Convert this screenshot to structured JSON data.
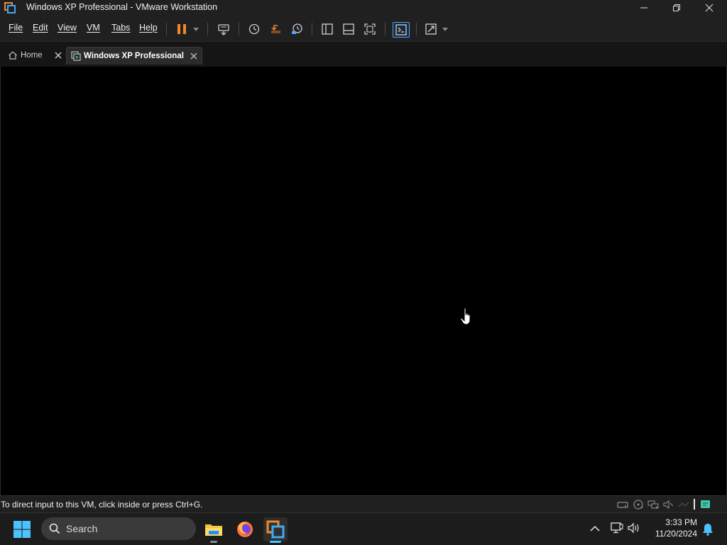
{
  "window": {
    "title": "Windows XP Professional - VMware Workstation",
    "controls": [
      "minimize-icon",
      "restore-icon",
      "close-icon"
    ]
  },
  "menu": {
    "items": [
      "File",
      "Edit",
      "View",
      "VM",
      "Tabs",
      "Help"
    ]
  },
  "toolbar": {
    "buttons": [
      "pause-icon",
      "dropdown-arrow-icon",
      "send-ctrl-alt-del-icon",
      "snapshot-icon",
      "revert-snapshot-icon",
      "snapshot-manager-icon",
      "show-library-icon",
      "thumbnail-bar-icon",
      "full-screen-icon",
      "console-view-icon",
      "stretch-guest-icon",
      "dropdown-arrow-icon"
    ],
    "pause_color": "#f0892d",
    "active_color": "#4da3ff"
  },
  "tabs": [
    {
      "label": "Home",
      "icon": "home-icon",
      "active": false
    },
    {
      "label": "Windows XP Professional",
      "icon": "vm-icon",
      "active": true
    }
  ],
  "statusbar": {
    "message": "To direct input to this VM, click inside or press Ctrl+G.",
    "devices": [
      "hard-disk-icon",
      "cd-dvd-icon",
      "network-adapter-icon",
      "sound-card-icon",
      "usb-icon",
      "message-log-icon"
    ]
  },
  "taskbar": {
    "search_placeholder": "Search",
    "apps": [
      "file-explorer-icon",
      "firefox-icon",
      "vmware-workstation-icon"
    ],
    "tray": [
      "show-hidden-icons-icon",
      "network-icon",
      "volume-icon",
      "notification-bell-icon"
    ],
    "time": "3:33 PM",
    "date": "11/20/2024"
  }
}
